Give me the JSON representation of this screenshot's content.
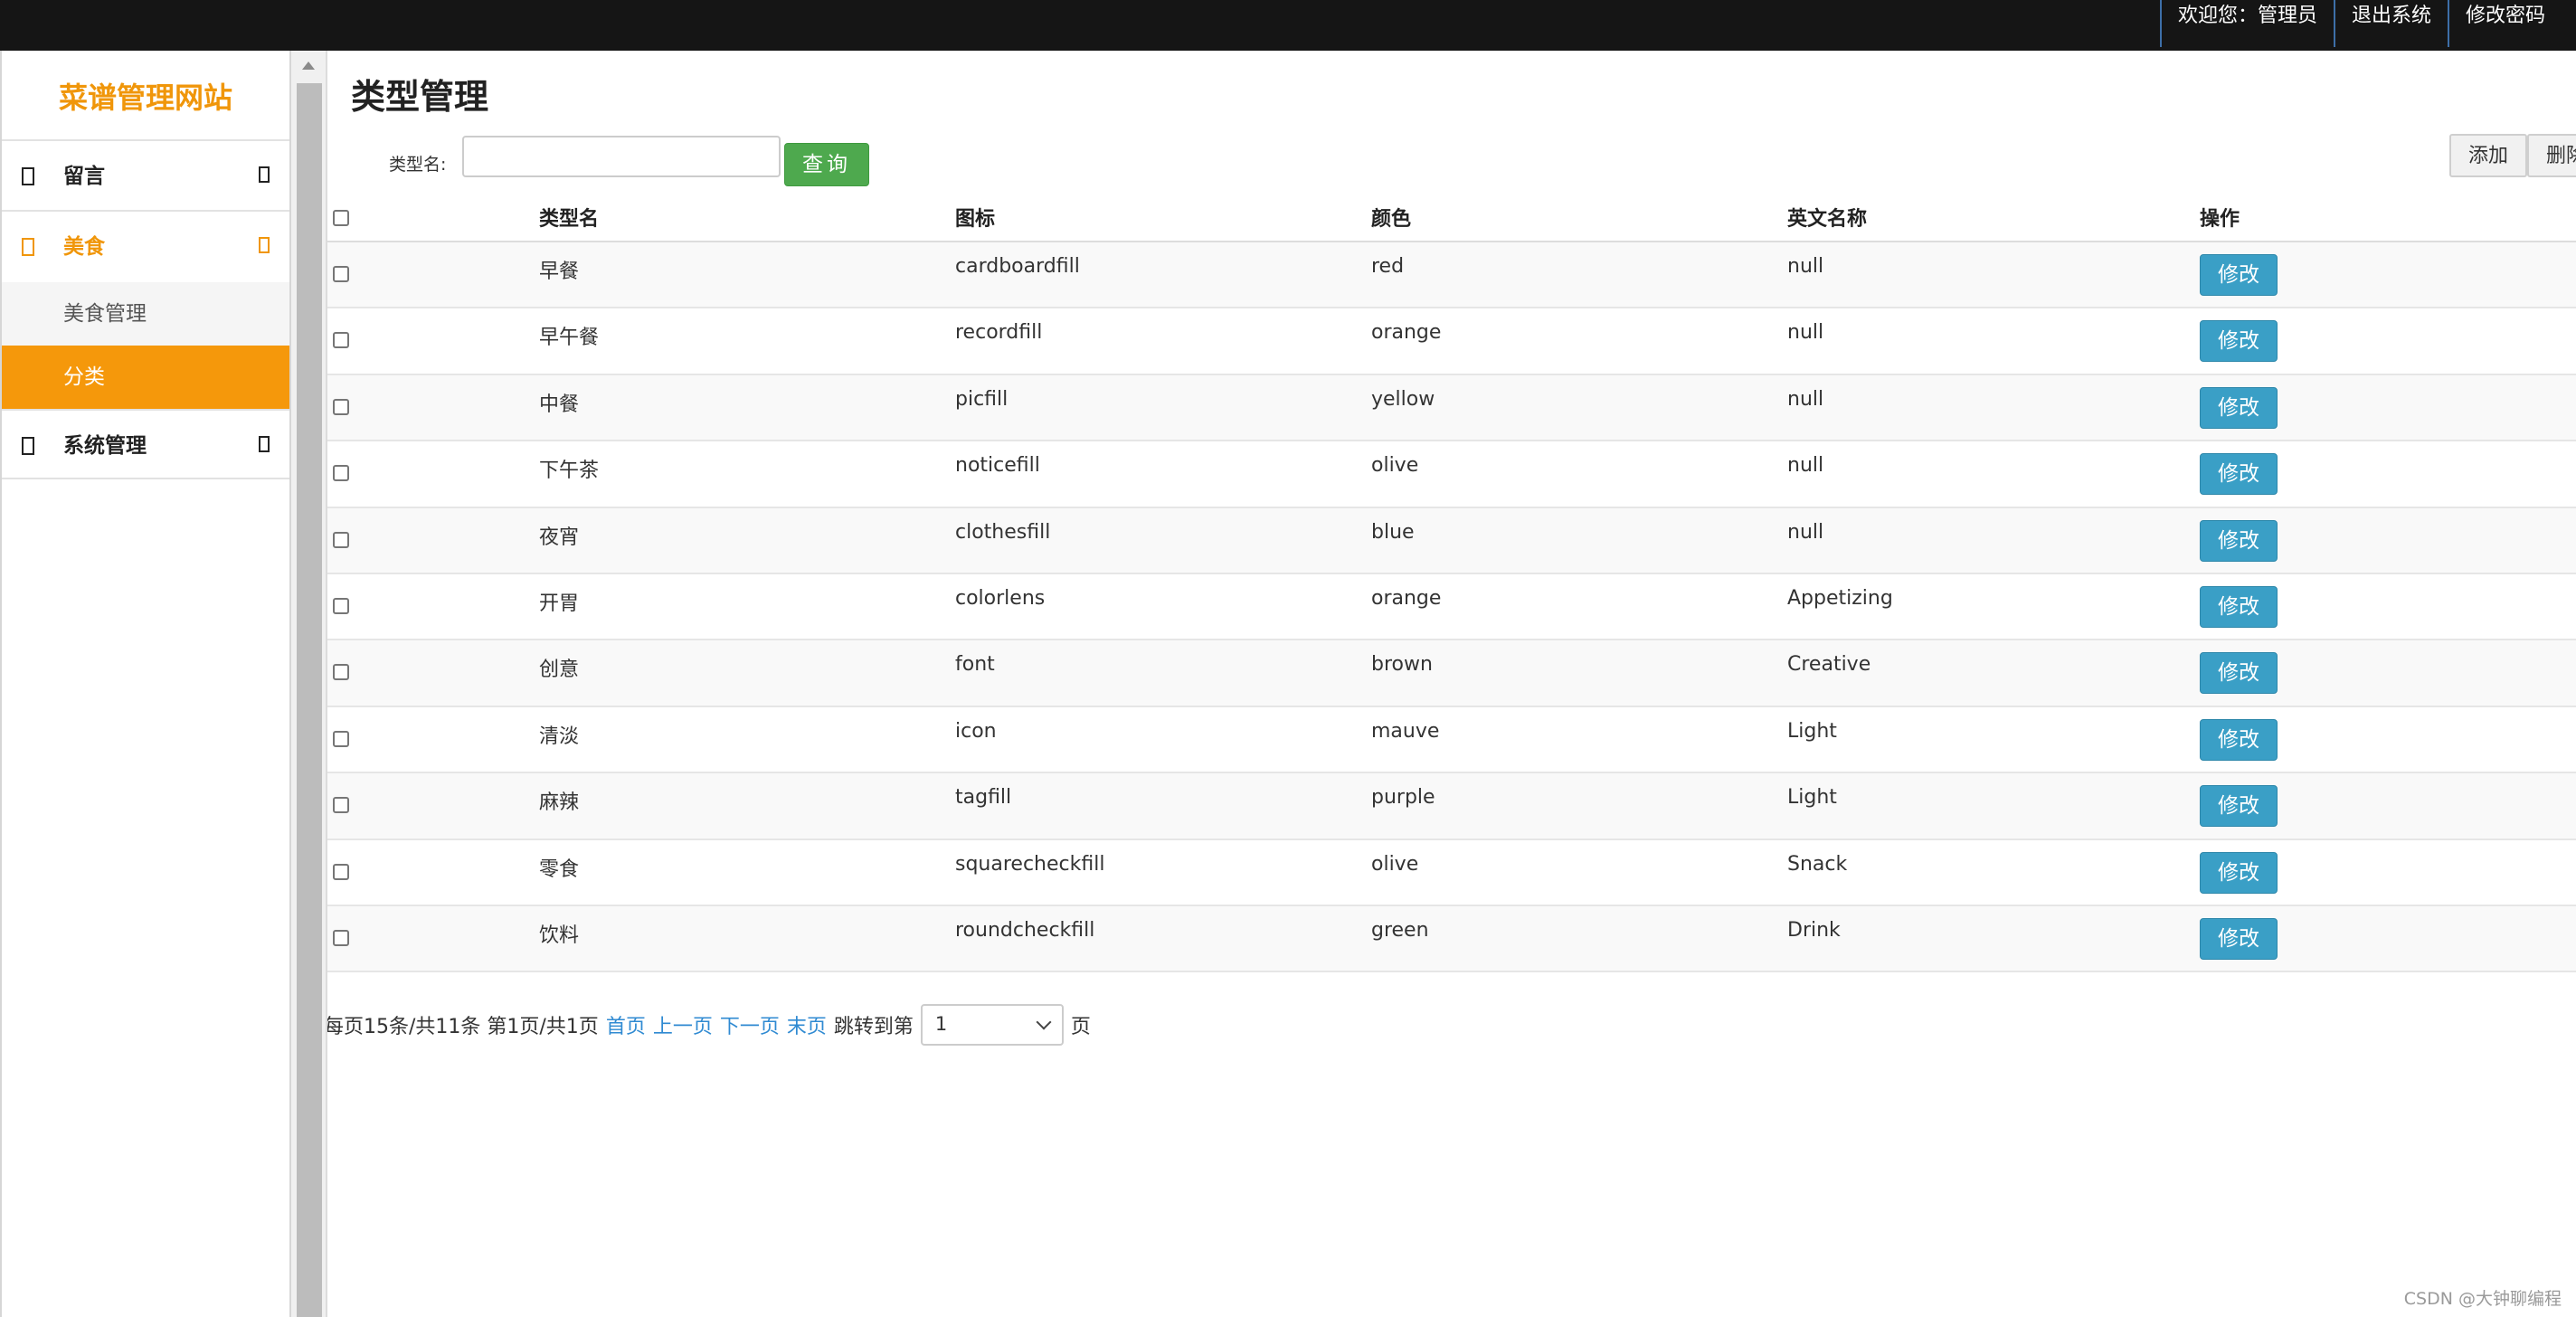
{
  "topbar": {
    "welcome": "欢迎您：管理员",
    "logout": "退出系统",
    "change_password": "修改密码"
  },
  "sidebar": {
    "brand": "菜谱管理网站",
    "items": [
      {
        "label": "留言",
        "icon": "message-icon"
      },
      {
        "label": "美食",
        "icon": "food-icon",
        "expanded": true,
        "children": [
          {
            "label": "美食管理"
          },
          {
            "label": "分类",
            "selected": true
          }
        ]
      },
      {
        "label": "系统管理",
        "icon": "settings-icon"
      }
    ]
  },
  "main": {
    "title": "类型管理",
    "search": {
      "label": "类型名:",
      "value": "",
      "button": "查询"
    },
    "toolbar": {
      "add": "添加",
      "delete": "删除"
    },
    "table": {
      "headers": [
        "类型名",
        "图标",
        "颜色",
        "英文名称",
        "操作"
      ],
      "edit_label": "修改",
      "rows": [
        [
          "早餐",
          "cardboardfill",
          "red",
          "null"
        ],
        [
          "早午餐",
          "recordfill",
          "orange",
          "null"
        ],
        [
          "中餐",
          "picfill",
          "yellow",
          "null"
        ],
        [
          "下午茶",
          "noticefill",
          "olive",
          "null"
        ],
        [
          "夜宵",
          "clothesfill",
          "blue",
          "null"
        ],
        [
          "开胃",
          "colorlens",
          "orange",
          "Appetizing"
        ],
        [
          "创意",
          "font",
          "brown",
          "Creative"
        ],
        [
          "清淡",
          "icon",
          "mauve",
          "Light"
        ],
        [
          "麻辣",
          "tagfill",
          "purple",
          "Light"
        ],
        [
          "零食",
          "squarecheckfill",
          "olive",
          "Snack"
        ],
        [
          "饮料",
          "roundcheckfill",
          "green",
          "Drink"
        ]
      ]
    },
    "pager": {
      "summary": "每页15条/共11条 第1页/共1页",
      "first": "首页",
      "prev": "上一页",
      "next": "下一页",
      "last": "末页",
      "jump_label": "跳转到第",
      "page_value": "1",
      "page_suffix": "页"
    }
  },
  "watermark": "CSDN @大钟聊编程",
  "colors": {
    "accent": "#f5980b",
    "topbar": "#151515",
    "search_button": "#4ea94e",
    "edit_button": "#3a9fc6",
    "link": "#2f8ad2"
  }
}
